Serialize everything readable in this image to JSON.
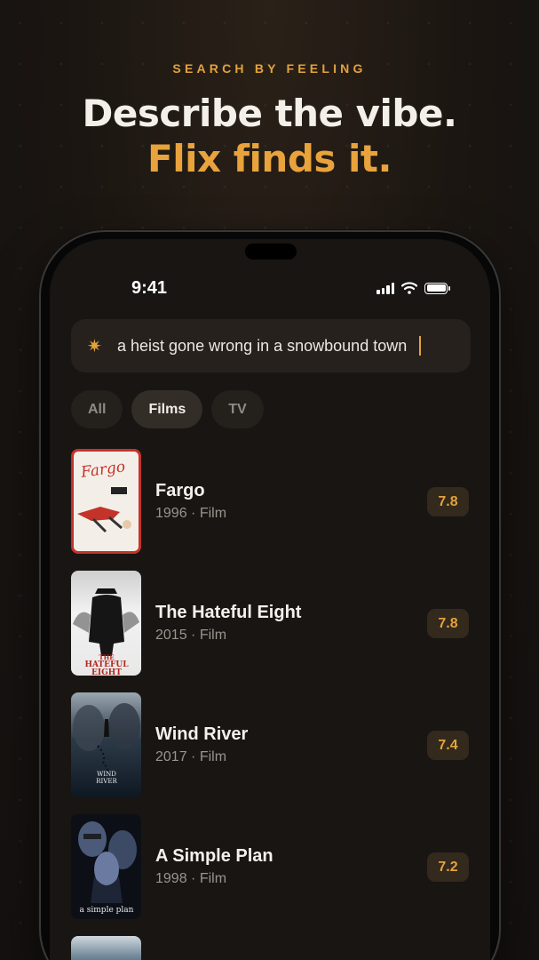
{
  "header": {
    "eyebrow": "SEARCH BY FEELING",
    "line1": "Describe the vibe.",
    "line2": "Flix finds it."
  },
  "status_bar": {
    "time": "9:41"
  },
  "search": {
    "icon": "sparkle-icon",
    "query": "a heist gone wrong in a snowbound town"
  },
  "filters": [
    {
      "label": "All",
      "active": false
    },
    {
      "label": "Films",
      "active": true
    },
    {
      "label": "TV",
      "active": false
    }
  ],
  "results": [
    {
      "title": "Fargo",
      "meta": "1996 · Film",
      "rating": "7.8",
      "poster_text": "Fargo"
    },
    {
      "title": "The Hateful Eight",
      "meta": "2015 · Film",
      "rating": "7.8",
      "poster_text": "THE HATEFUL EIGHT"
    },
    {
      "title": "Wind River",
      "meta": "2017 · Film",
      "rating": "7.4",
      "poster_text": "WIND RIVER"
    },
    {
      "title": "A Simple Plan",
      "meta": "1998 · Film",
      "rating": "7.2",
      "poster_text": "a simple plan"
    }
  ],
  "colors": {
    "accent": "#e3a23d",
    "background": "#181513",
    "chip_active": "#332d27"
  }
}
